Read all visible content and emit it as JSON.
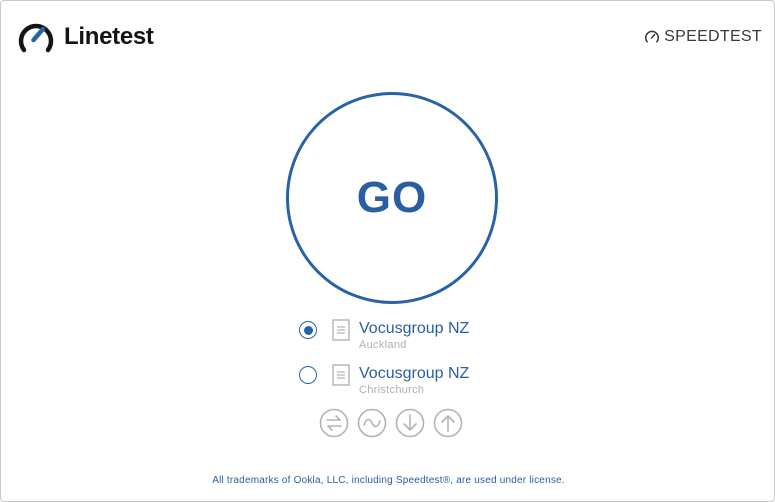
{
  "header": {
    "app_name": "Linetest",
    "brand_name": "SPEEDTEST",
    "logo_icon": "speedometer-icon",
    "brand_icon": "gauge-icon"
  },
  "main": {
    "go_label": "GO"
  },
  "servers": [
    {
      "name": "Vocusgroup NZ",
      "location": "Auckland",
      "selected": true
    },
    {
      "name": "Vocusgroup NZ",
      "location": "Christchurch",
      "selected": false
    }
  ],
  "test_modes": [
    {
      "icon": "ping-arrows-icon"
    },
    {
      "icon": "jitter-wave-icon"
    },
    {
      "icon": "download-arrow-icon"
    },
    {
      "icon": "upload-arrow-icon"
    }
  ],
  "footer": {
    "text": "All trademarks of Ookla, LLC, including Speedtest®, are used under license."
  },
  "colors": {
    "accent": "#2a62a8",
    "muted_icon": "#b3b3b3",
    "text_dark": "#141414",
    "location_gray": "#b0b0b0"
  }
}
